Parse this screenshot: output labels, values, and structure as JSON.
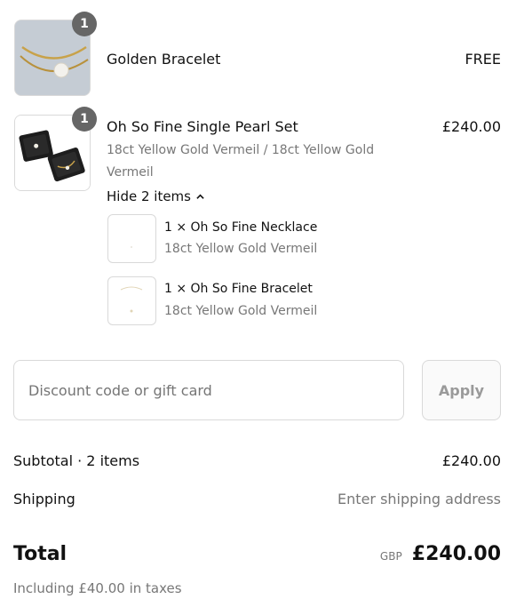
{
  "items": [
    {
      "title": "Golden Bracelet",
      "price": "FREE",
      "quantity_badge": "1",
      "image_icon": "bracelet-photo"
    },
    {
      "title": "Oh So Fine Single Pearl Set",
      "price": "£240.00",
      "quantity_badge": "1",
      "variant": "18ct Yellow Gold Vermeil / 18ct Yellow Gold Vermeil",
      "image_icon": "jewelry-box-photo",
      "toggle_label": "Hide 2 items",
      "bundle": [
        {
          "title": "1 × Oh So Fine Necklace",
          "variant": "18ct Yellow Gold Vermeil"
        },
        {
          "title": "1 × Oh So Fine Bracelet",
          "variant": "18ct Yellow Gold Vermeil"
        }
      ]
    }
  ],
  "discount": {
    "placeholder": "Discount code or gift card",
    "apply_label": "Apply"
  },
  "summary": {
    "subtotal_label": "Subtotal · 2 items",
    "subtotal_value": "£240.00",
    "shipping_label": "Shipping",
    "shipping_value": "Enter shipping address",
    "total_label": "Total",
    "currency": "GBP",
    "total_value": "£240.00",
    "taxes_note": "Including £40.00 in taxes"
  }
}
